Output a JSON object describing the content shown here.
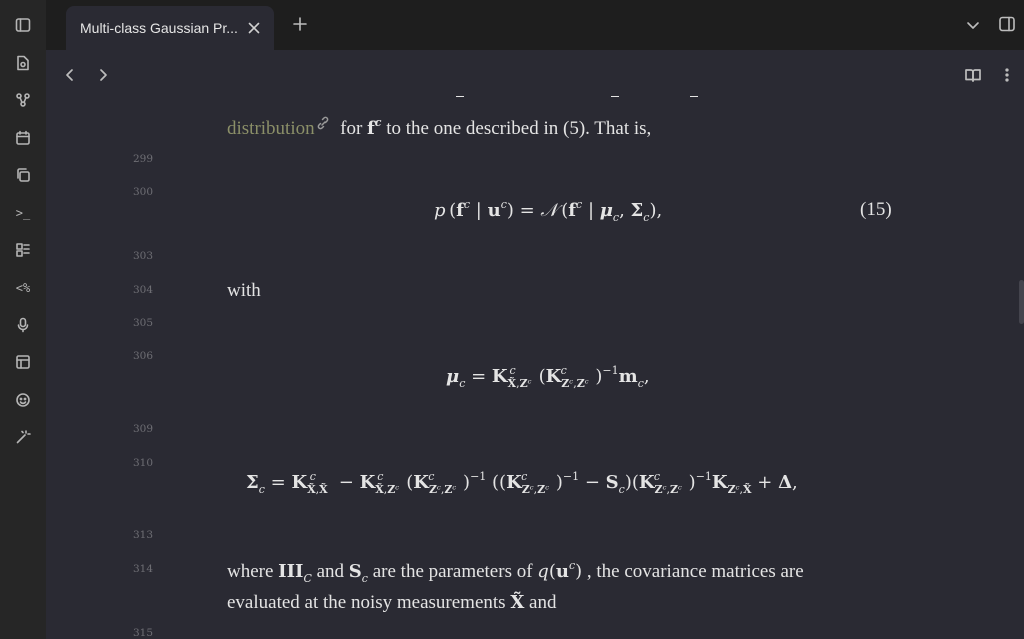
{
  "tab": {
    "title": "Multi-class Gaussian Pr..."
  },
  "icons": {
    "ribbon": [
      "sidebar-toggle-icon",
      "file-search-icon",
      "graph-icon",
      "calendar-icon",
      "copy-icon",
      "terminal-icon",
      "kanban-icon",
      "percent-code-icon",
      "microphone-icon",
      "layout-icon",
      "smiley-icon",
      "magic-wand-icon"
    ]
  },
  "ribbon_text": {
    "percent": "<%",
    "terminal": ">_"
  },
  "line_numbers": [
    "299",
    "300",
    "303",
    "304",
    "305",
    "306",
    "309",
    "310",
    "313",
    "314",
    "315"
  ],
  "content": {
    "line1_link": "distribution",
    "line1_rest": "for",
    "line1_mid": "to the one described in (5). That is,",
    "eq15_number": "(15)",
    "with": "with",
    "where_text": "where",
    "and_text": "and",
    "are_params": "are the parameters of",
    "cov_text": ", the covariance matrices are",
    "evaluated": "evaluated at the noisy measurements",
    "and_end": "and"
  }
}
